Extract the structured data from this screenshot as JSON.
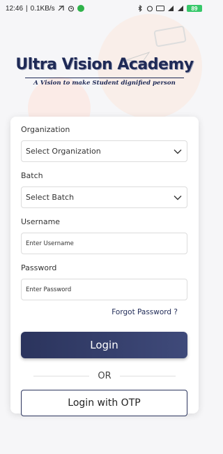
{
  "status_bar": {
    "time": "12:46",
    "network_speed": "0.1KB/s",
    "battery": "89"
  },
  "brand": {
    "title": "Ultra Vision Academy",
    "tagline": "A Vision to make Student dignified person"
  },
  "form": {
    "organization": {
      "label": "Organization",
      "value": "Select Organization"
    },
    "batch": {
      "label": "Batch",
      "value": "Select Batch"
    },
    "username": {
      "label": "Username",
      "placeholder": "Enter Username"
    },
    "password": {
      "label": "Password",
      "placeholder": "Enter Password"
    },
    "forgot_password": "Forgot Password ?",
    "login_button": "Login",
    "or_text": "OR",
    "otp_button": "Login with OTP"
  },
  "colors": {
    "primary": "#2b345d",
    "brand": "#1f2a56",
    "battery": "#37c86a"
  }
}
